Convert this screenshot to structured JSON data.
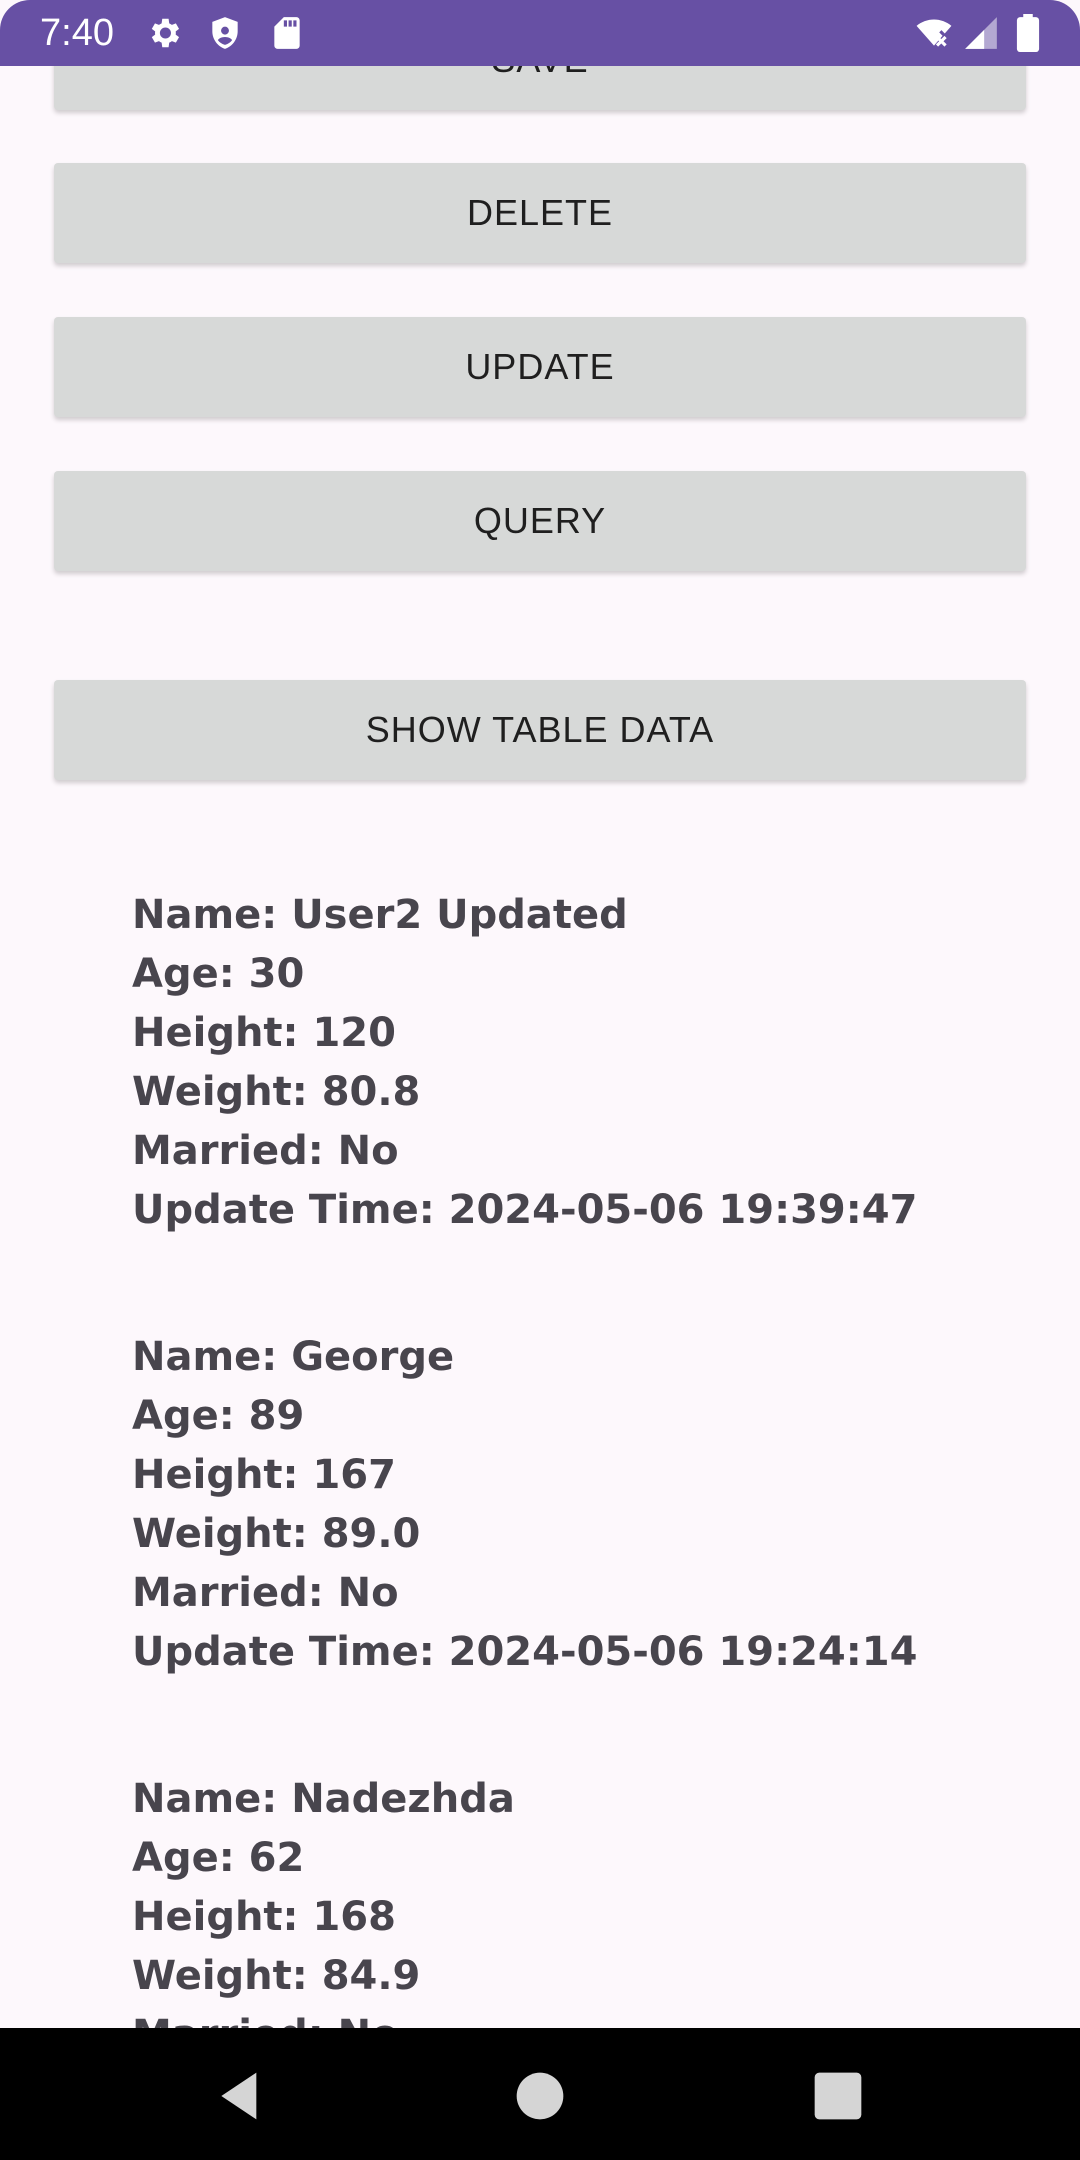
{
  "status_bar": {
    "time": "7:40",
    "icons": [
      "gear-icon",
      "shield-icon",
      "sd-card-icon",
      "wifi-off-icon",
      "cell-signal-icon",
      "battery-icon"
    ]
  },
  "buttons": {
    "save": "SAVE",
    "delete": "DELETE",
    "update": "UPDATE",
    "query": "QUERY",
    "show_table_data": "SHOW TABLE DATA"
  },
  "records": [
    {
      "name": "Name: User2 Updated",
      "age": "Age: 30",
      "height": "Height: 120",
      "weight": "Weight: 80.8",
      "married": "Married: No",
      "update_time": "Update Time: 2024-05-06 19:39:47"
    },
    {
      "name": "Name: George",
      "age": "Age: 89",
      "height": "Height: 167",
      "weight": "Weight: 89.0",
      "married": "Married: No",
      "update_time": "Update Time: 2024-05-06 19:24:14"
    },
    {
      "name": "Name: Nadezhda",
      "age": "Age: 62",
      "height": "Height: 168",
      "weight": "Weight: 84.9",
      "married": "Married: No"
    }
  ],
  "nav_bar": {
    "icons": [
      "back-icon",
      "home-icon",
      "recents-icon"
    ]
  },
  "colors": {
    "status_bar": "#6750a4",
    "background": "#fdf8fc",
    "button": "#d7d9d8",
    "record_text": "#48454d",
    "nav_bar": "#000000"
  }
}
